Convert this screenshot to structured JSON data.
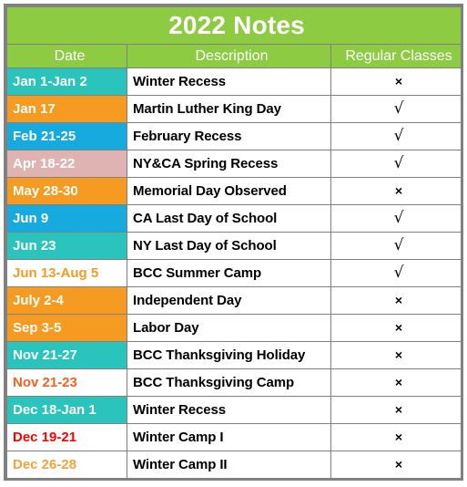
{
  "title": "2022 Notes",
  "colors": {
    "header_green": "#8DCB43",
    "teal": "#2BC4BC",
    "orange": "#F59B22",
    "blue": "#17AADF",
    "pink": "#E0B3B3",
    "white": "#FFFFFF",
    "text_white": "#FFFFFF",
    "text_orange": "#F59B22",
    "text_orange_red": "#F4621F",
    "text_red": "#FF0000",
    "text_amber": "#F9A13A",
    "border_gray": "#808080",
    "text_black": "#000000"
  },
  "columns": [
    {
      "key": "date",
      "label": "Date"
    },
    {
      "key": "description",
      "label": "Description"
    },
    {
      "key": "regular_classes",
      "label": "Regular Classes"
    }
  ],
  "marks": {
    "yes": "√",
    "no": "×"
  },
  "rows": [
    {
      "date": "Jan 1-Jan 2",
      "description": "Winter Recess",
      "regular_classes": "×",
      "regular_classes_state": "no",
      "date_bg": "#2BC4BC",
      "date_fg": "#FFFFFF"
    },
    {
      "date": "Jan 17",
      "description": "Martin Luther King Day",
      "regular_classes": "√",
      "regular_classes_state": "yes",
      "date_bg": "#F59B22",
      "date_fg": "#FFFFFF"
    },
    {
      "date": "Feb 21-25",
      "description": "February Recess",
      "regular_classes": "√",
      "regular_classes_state": "yes",
      "date_bg": "#17AADF",
      "date_fg": "#FFFFFF"
    },
    {
      "date": "Apr 18-22",
      "description": "NY&CA Spring Recess",
      "regular_classes": "√",
      "regular_classes_state": "yes",
      "date_bg": "#E0B3B3",
      "date_fg": "#FFFFFF"
    },
    {
      "date": "May 28-30",
      "description": "Memorial Day Observed",
      "regular_classes": "×",
      "regular_classes_state": "no",
      "date_bg": "#F59B22",
      "date_fg": "#FFFFFF"
    },
    {
      "date": "Jun 9",
      "description": "CA Last Day of School",
      "regular_classes": "√",
      "regular_classes_state": "yes",
      "date_bg": "#17AADF",
      "date_fg": "#FFFFFF"
    },
    {
      "date": "Jun 23",
      "description": "NY Last Day of School",
      "regular_classes": "√",
      "regular_classes_state": "yes",
      "date_bg": "#2BC4BC",
      "date_fg": "#FFFFFF"
    },
    {
      "date": "Jun 13-Aug 5",
      "description": "BCC Summer Camp",
      "regular_classes": "√",
      "regular_classes_state": "yes",
      "date_bg": "#FFFFFF",
      "date_fg": "#F59B22"
    },
    {
      "date": "July 2-4",
      "description": "Independent Day",
      "regular_classes": "×",
      "regular_classes_state": "no",
      "date_bg": "#F59B22",
      "date_fg": "#FFFFFF"
    },
    {
      "date": "Sep 3-5",
      "description": "Labor Day",
      "regular_classes": "×",
      "regular_classes_state": "no",
      "date_bg": "#F59B22",
      "date_fg": "#FFFFFF"
    },
    {
      "date": "Nov 21-27",
      "description": "BCC Thanksgiving Holiday",
      "regular_classes": "×",
      "regular_classes_state": "no",
      "date_bg": "#2BC4BC",
      "date_fg": "#FFFFFF"
    },
    {
      "date": "Nov 21-23",
      "description": "BCC Thanksgiving Camp",
      "regular_classes": "×",
      "regular_classes_state": "no",
      "date_bg": "#FFFFFF",
      "date_fg": "#F4621F"
    },
    {
      "date": "Dec 18-Jan 1",
      "description": "Winter Recess",
      "regular_classes": "×",
      "regular_classes_state": "no",
      "date_bg": "#2BC4BC",
      "date_fg": "#FFFFFF"
    },
    {
      "date": "Dec 19-21",
      "description": "Winter Camp I",
      "regular_classes": "×",
      "regular_classes_state": "no",
      "date_bg": "#FFFFFF",
      "date_fg": "#FF0000"
    },
    {
      "date": "Dec 26-28",
      "description": "Winter Camp II",
      "regular_classes": "×",
      "regular_classes_state": "no",
      "date_bg": "#FFFFFF",
      "date_fg": "#F9A13A"
    }
  ]
}
